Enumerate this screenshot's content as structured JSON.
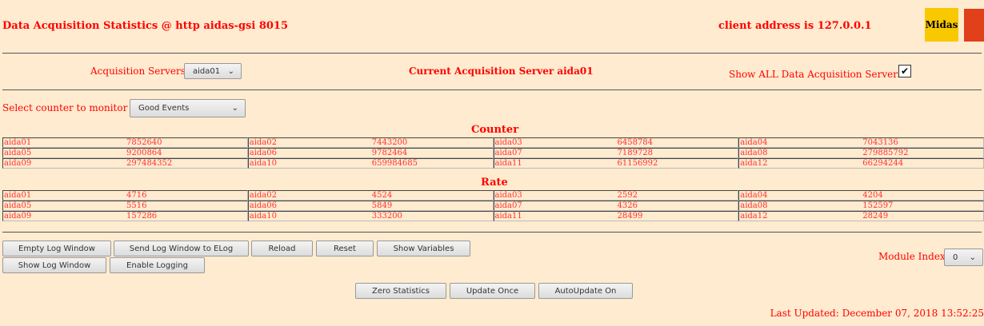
{
  "header": {
    "title": "Data Acquisition Statistics @ http aidas-gsi 8015",
    "client": "client address is 127.0.0.1",
    "logo": "Midas"
  },
  "servers": {
    "label": "Acquisition Servers",
    "selected": "aida01",
    "current": "Current Acquisition Server aida01",
    "show_all": "Show ALL Data Acquisition Servers?",
    "show_all_checked": true
  },
  "counter_select": {
    "label": "Select counter to monitor",
    "selected": "Good Events"
  },
  "counter": {
    "title": "Counter",
    "rows": [
      [
        [
          "aida01",
          "7852640"
        ],
        [
          "aida02",
          "7443200"
        ],
        [
          "aida03",
          "6458784"
        ],
        [
          "aida04",
          "7043136"
        ]
      ],
      [
        [
          "aida05",
          "9200864"
        ],
        [
          "aida06",
          "9782464"
        ],
        [
          "aida07",
          "7189728"
        ],
        [
          "aida08",
          "279885792"
        ]
      ],
      [
        [
          "aida09",
          "297484352"
        ],
        [
          "aida10",
          "659984685"
        ],
        [
          "aida11",
          "61156992"
        ],
        [
          "aida12",
          "66294244"
        ]
      ]
    ]
  },
  "rate": {
    "title": "Rate",
    "rows": [
      [
        [
          "aida01",
          "4716"
        ],
        [
          "aida02",
          "4524"
        ],
        [
          "aida03",
          "2592"
        ],
        [
          "aida04",
          "4204"
        ]
      ],
      [
        [
          "aida05",
          "5516"
        ],
        [
          "aida06",
          "5849"
        ],
        [
          "aida07",
          "4326"
        ],
        [
          "aida08",
          "152597"
        ]
      ],
      [
        [
          "aida09",
          "157286"
        ],
        [
          "aida10",
          "333200"
        ],
        [
          "aida11",
          "28499"
        ],
        [
          "aida12",
          "28249"
        ]
      ]
    ]
  },
  "buttons": {
    "empty_log": "Empty Log Window",
    "send_log": "Send Log Window to ELog",
    "reload": "Reload",
    "reset": "Reset",
    "show_vars": "Show Variables",
    "show_log": "Show Log Window",
    "enable_logging": "Enable Logging",
    "zero": "Zero Statistics",
    "update_once": "Update Once",
    "autoupdate": "AutoUpdate On"
  },
  "module": {
    "label": "Module Index",
    "selected": "0"
  },
  "footer": {
    "last_updated": "Last Updated: December 07, 2018 13:52:25"
  }
}
